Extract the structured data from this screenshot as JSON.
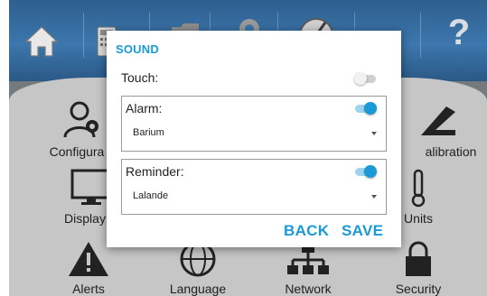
{
  "background": {
    "tiles": [
      {
        "label": "Configura"
      },
      {
        "label": "alibration"
      },
      {
        "label": "Display"
      },
      {
        "label": "Units"
      },
      {
        "label": "Alerts"
      },
      {
        "label": "Language"
      },
      {
        "label": "Network"
      },
      {
        "label": "Security"
      }
    ],
    "help_glyph": "?"
  },
  "dialog": {
    "title": "SOUND",
    "touch": {
      "label": "Touch:",
      "enabled": false
    },
    "alarm": {
      "label": "Alarm:",
      "enabled": true,
      "selected": "Barium"
    },
    "reminder": {
      "label": "Reminder:",
      "enabled": true,
      "selected": "Lalande"
    },
    "back_label": "BACK",
    "save_label": "SAVE"
  },
  "colors": {
    "accent": "#1a9ad6",
    "topbar": "#3c77ad",
    "content_bg": "#c6c6c6"
  }
}
